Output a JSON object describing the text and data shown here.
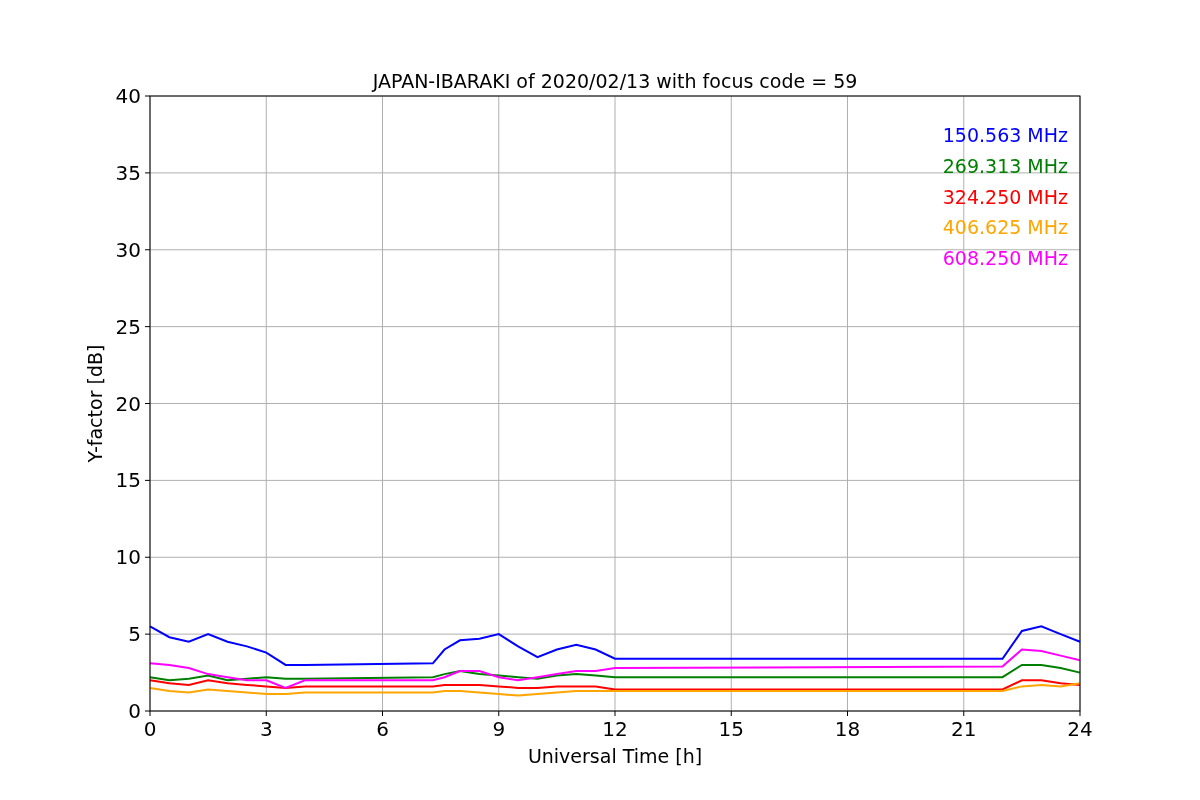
{
  "figure": {
    "chart_data": {
      "type": "line",
      "title": "JAPAN-IBARAKI of 2020/02/13 with focus code = 59",
      "xlabel": "Universal Time [h]",
      "ylabel": "Y-factor [dB]",
      "x": [
        0,
        0.5,
        1,
        1.5,
        2,
        2.5,
        3,
        3.5,
        4,
        7.3,
        7.6,
        8,
        8.5,
        9,
        9.5,
        10,
        10.5,
        11,
        11.5,
        12,
        22,
        22.5,
        23,
        23.5,
        24
      ],
      "series": [
        {
          "name": "150.563 MHz",
          "color": "#0000ff",
          "values": [
            5.5,
            4.8,
            4.5,
            5.0,
            4.5,
            4.2,
            3.8,
            3.0,
            3.0,
            3.1,
            4.0,
            4.6,
            4.7,
            5.0,
            4.2,
            3.5,
            4.0,
            4.3,
            4.0,
            3.4,
            3.4,
            5.2,
            5.5,
            5.0,
            4.5
          ]
        },
        {
          "name": "269.313 MHz",
          "color": "#008000",
          "values": [
            2.2,
            2.0,
            2.1,
            2.3,
            2.0,
            2.1,
            2.2,
            2.1,
            2.1,
            2.2,
            2.4,
            2.6,
            2.4,
            2.3,
            2.2,
            2.1,
            2.3,
            2.4,
            2.3,
            2.2,
            2.2,
            3.0,
            3.0,
            2.8,
            2.5
          ]
        },
        {
          "name": "324.250 MHz",
          "color": "#ff0000",
          "values": [
            2.0,
            1.8,
            1.7,
            2.0,
            1.8,
            1.7,
            1.6,
            1.5,
            1.6,
            1.6,
            1.7,
            1.7,
            1.7,
            1.6,
            1.5,
            1.5,
            1.6,
            1.6,
            1.6,
            1.4,
            1.4,
            2.0,
            2.0,
            1.8,
            1.7
          ]
        },
        {
          "name": "406.625 MHz",
          "color": "#ffa500",
          "values": [
            1.5,
            1.3,
            1.2,
            1.4,
            1.3,
            1.2,
            1.1,
            1.1,
            1.2,
            1.2,
            1.3,
            1.3,
            1.2,
            1.1,
            1.0,
            1.1,
            1.2,
            1.3,
            1.3,
            1.3,
            1.3,
            1.6,
            1.7,
            1.6,
            1.8
          ]
        },
        {
          "name": "608.250 MHz",
          "color": "#ff00ff",
          "values": [
            3.1,
            3.0,
            2.8,
            2.4,
            2.2,
            2.0,
            2.0,
            1.5,
            2.0,
            2.0,
            2.2,
            2.6,
            2.6,
            2.2,
            2.0,
            2.2,
            2.4,
            2.6,
            2.6,
            2.8,
            2.9,
            4.0,
            3.9,
            3.6,
            3.3
          ]
        }
      ],
      "xlim": [
        0,
        24
      ],
      "ylim": [
        0,
        40
      ],
      "xticks": [
        0,
        3,
        6,
        9,
        12,
        15,
        18,
        21,
        24
      ],
      "yticks": [
        0,
        5,
        10,
        15,
        20,
        25,
        30,
        35,
        40
      ],
      "grid": true
    }
  }
}
